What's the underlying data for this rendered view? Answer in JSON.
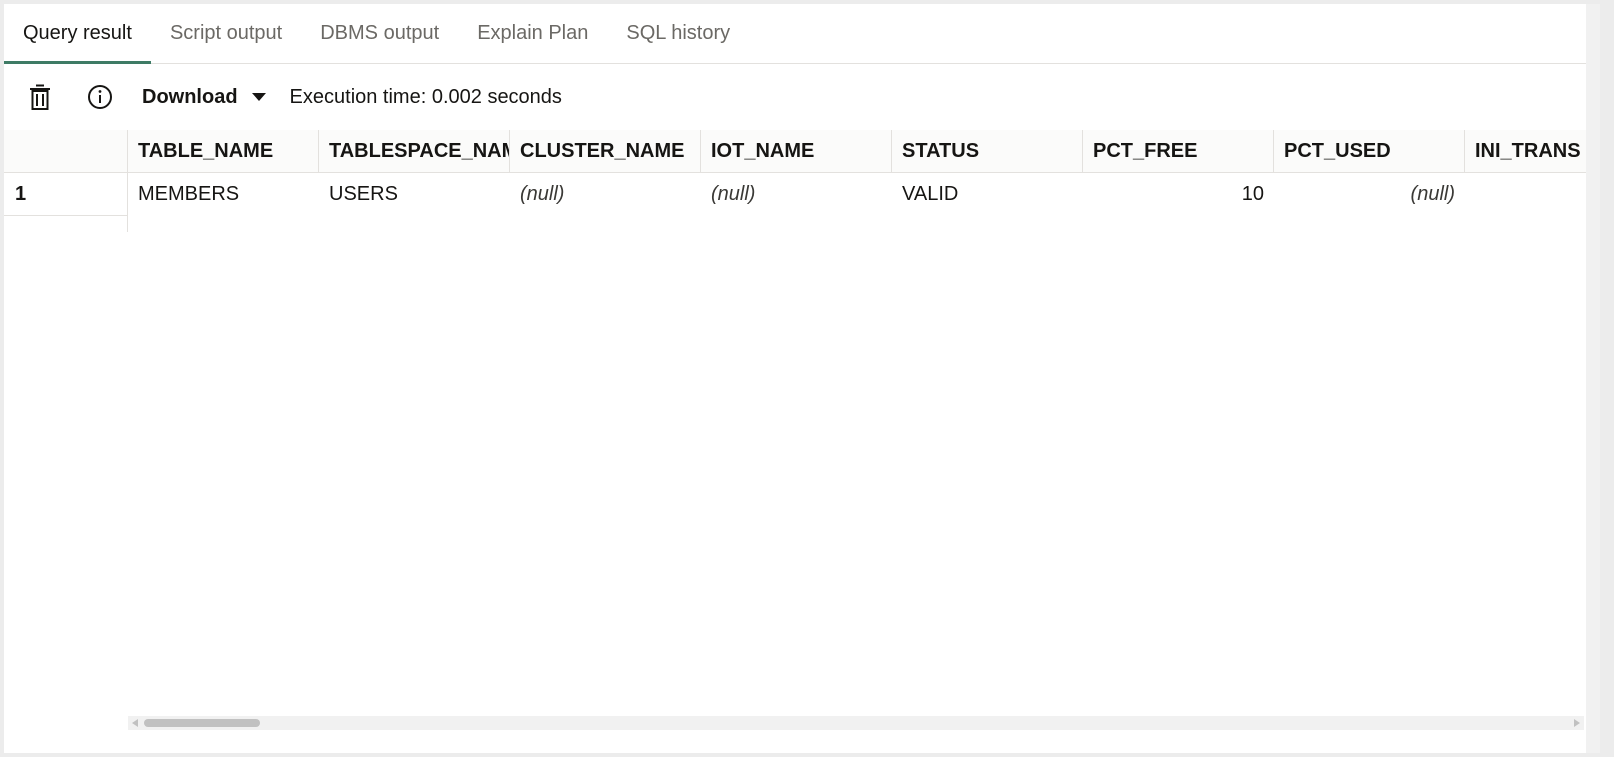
{
  "tabs": [
    {
      "label": "Query result",
      "active": true
    },
    {
      "label": "Script output",
      "active": false
    },
    {
      "label": "DBMS output",
      "active": false
    },
    {
      "label": "Explain Plan",
      "active": false
    },
    {
      "label": "SQL history",
      "active": false
    }
  ],
  "toolbar": {
    "trash_icon": "trash-icon",
    "info_icon": "info-icon",
    "download_label": "Download",
    "execution_time": "Execution time: 0.002 seconds"
  },
  "grid": {
    "columns": [
      "TABLE_NAME",
      "TABLESPACE_NAME",
      "CLUSTER_NAME",
      "IOT_NAME",
      "STATUS",
      "PCT_FREE",
      "PCT_USED",
      "INI_TRANS"
    ],
    "rows": [
      {
        "num": "1",
        "cells": [
          "MEMBERS",
          "USERS",
          "(null)",
          "(null)",
          "VALID",
          "10",
          "(null)",
          ""
        ]
      }
    ]
  },
  "colors": {
    "accent": "#3e7b65",
    "border": "#e3e1de"
  }
}
